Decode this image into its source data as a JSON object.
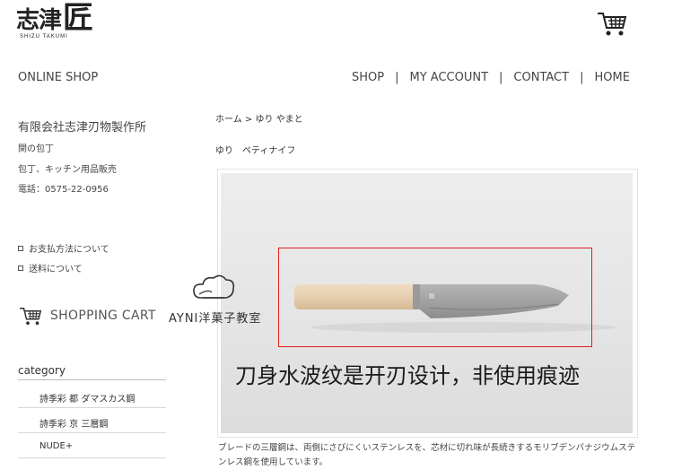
{
  "header": {
    "logo_text": "志津",
    "logo_big": "匠",
    "logo_subtitle": "SHIZU TAKUMI",
    "cart_icon": "shopping-cart-icon"
  },
  "nav": {
    "online_shop": "ONLINE SHOP",
    "items": [
      {
        "label": "SHOP"
      },
      {
        "label": "MY ACCOUNT"
      },
      {
        "label": "CONTACT"
      },
      {
        "label": "HOME"
      }
    ],
    "separator": "|"
  },
  "sidebar": {
    "company": "有限会社志津刃物製作所",
    "lines": [
      "関の包丁",
      "包丁、キッチン用品販売",
      "電話：0575-22-0956"
    ],
    "links": [
      {
        "label": "お支払方法について"
      },
      {
        "label": "送料について"
      }
    ],
    "shopping_cart": "SHOPPING CART",
    "category_title": "category",
    "categories": [
      {
        "label": "詩季彩 都 ダマスカス鋼"
      },
      {
        "label": "詩季彩 京 三層鋼"
      },
      {
        "label": "NUDE+"
      }
    ]
  },
  "main": {
    "breadcrumb": {
      "home": "ホーム",
      "sep": " > ",
      "current": "ゆり やまと"
    },
    "product_name": "ゆり　ペティナイフ",
    "image_caption": "刀身水波纹是开刃设计，非使用痕迹",
    "watermark": "AYNI洋菓子教室",
    "description": "ブレードの三層鋼は、両側にさびにくいステンレスを、芯材に切れ味が長続きするモリブデンバナジウムステンレス鋼を使用しています。"
  },
  "colors": {
    "highlight_box": "#e02020"
  }
}
